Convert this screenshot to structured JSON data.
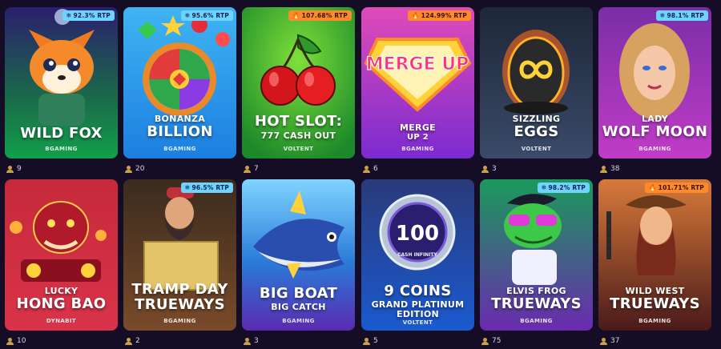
{
  "colors": {
    "background": "#150d26",
    "badge_cold": "#6fd3ff",
    "badge_hot": "#ff8a2b"
  },
  "games": [
    {
      "title_lines": [
        "WILD FOX"
      ],
      "provider": "BGAMING",
      "players": "9",
      "rtp": "92.3% RTP",
      "rtp_kind": "cold"
    },
    {
      "title_lines": [
        "BONANZA",
        "BILLION"
      ],
      "provider": "BGAMING",
      "players": "20",
      "rtp": "95.6% RTP",
      "rtp_kind": "cold"
    },
    {
      "title_lines": [
        "HOT SLOT:",
        "777 CASH OUT"
      ],
      "provider": "VOLTENT",
      "players": "7",
      "rtp": "107.68% RTP",
      "rtp_kind": "hot"
    },
    {
      "title_lines": [
        "MERGE",
        "UP 2"
      ],
      "provider": "BGAMING",
      "players": "6",
      "rtp": "124.99% RTP",
      "rtp_kind": "hot"
    },
    {
      "title_lines": [
        "SIZZLING",
        "EGGS"
      ],
      "provider": "VOLTENT",
      "players": "3",
      "rtp": "",
      "rtp_kind": "none"
    },
    {
      "title_lines": [
        "LADY",
        "WOLF MOON"
      ],
      "provider": "BGAMING",
      "players": "38",
      "rtp": "98.1% RTP",
      "rtp_kind": "cold"
    },
    {
      "title_lines": [
        "LUCKY",
        "HONG BAO"
      ],
      "provider": "DYNABIT",
      "players": "10",
      "rtp": "",
      "rtp_kind": "none"
    },
    {
      "title_lines": [
        "TRAMP DAY",
        "TRUEWAYS"
      ],
      "provider": "BGAMING",
      "players": "2",
      "rtp": "96.5% RTP",
      "rtp_kind": "cold"
    },
    {
      "title_lines": [
        "BIG BOAT",
        "BIG CATCH"
      ],
      "provider": "BGAMING",
      "players": "3",
      "rtp": "",
      "rtp_kind": "none"
    },
    {
      "title_lines": [
        "9 COINS",
        "GRAND PLATINUM",
        "EDITION"
      ],
      "provider": "VOLTENT",
      "players": "5",
      "rtp": "",
      "rtp_kind": "none"
    },
    {
      "title_lines": [
        "ELVIS FROG",
        "TRUEWAYS"
      ],
      "provider": "BGAMING",
      "players": "75",
      "rtp": "98.2% RTP",
      "rtp_kind": "cold"
    },
    {
      "title_lines": [
        "WILD WEST",
        "TRUEWAYS"
      ],
      "provider": "BGAMING",
      "players": "37",
      "rtp": "101.71% RTP",
      "rtp_kind": "hot"
    }
  ],
  "art_text": {
    "merge_logo": "MERGE UP",
    "coin_number": "100",
    "coin_caption": "CASH INFINITY"
  }
}
